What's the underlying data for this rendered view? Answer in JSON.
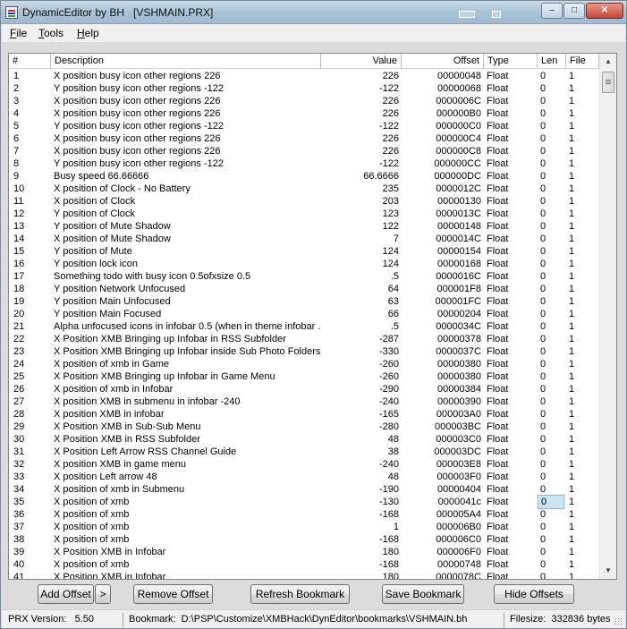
{
  "window": {
    "title": "DynamicEditor by BH   [VSHMAIN.PRX]"
  },
  "menubar": {
    "file": "File",
    "tools": "Tools",
    "help": "Help"
  },
  "columns": {
    "num": "#",
    "description": "Description",
    "value": "Value",
    "offset": "Offset",
    "type": "Type",
    "len": "Len",
    "file": "File"
  },
  "rows": [
    {
      "n": "1",
      "d": "X position busy icon other regions 226",
      "v": "226",
      "o": "00000048",
      "t": "Float",
      "l": "0",
      "f": "1"
    },
    {
      "n": "2",
      "d": "Y position busy icon other regions -122",
      "v": "-122",
      "o": "00000068",
      "t": "Float",
      "l": "0",
      "f": "1"
    },
    {
      "n": "3",
      "d": "X position busy icon other regions 226",
      "v": "226",
      "o": "0000006C",
      "t": "Float",
      "l": "0",
      "f": "1"
    },
    {
      "n": "4",
      "d": "X position busy icon other regions 226",
      "v": "226",
      "o": "000000B0",
      "t": "Float",
      "l": "0",
      "f": "1"
    },
    {
      "n": "5",
      "d": "Y position busy icon other regions -122",
      "v": "-122",
      "o": "000000C0",
      "t": "Float",
      "l": "0",
      "f": "1"
    },
    {
      "n": "6",
      "d": "X position busy icon other regions 226",
      "v": "226",
      "o": "000000C4",
      "t": "Float",
      "l": "0",
      "f": "1"
    },
    {
      "n": "7",
      "d": "X position busy icon other regions 226",
      "v": "226",
      "o": "000000C8",
      "t": "Float",
      "l": "0",
      "f": "1"
    },
    {
      "n": "8",
      "d": "Y position busy icon other regions -122",
      "v": "-122",
      "o": "000000CC",
      "t": "Float",
      "l": "0",
      "f": "1"
    },
    {
      "n": "9",
      "d": "Busy speed 66.66666",
      "v": "66.6666",
      "o": "000000DC",
      "t": "Float",
      "l": "0",
      "f": "1"
    },
    {
      "n": "10",
      "d": "X position of Clock - No Battery",
      "v": "235",
      "o": "0000012C",
      "t": "Float",
      "l": "0",
      "f": "1"
    },
    {
      "n": "11",
      "d": "X position of Clock",
      "v": "203",
      "o": "00000130",
      "t": "Float",
      "l": "0",
      "f": "1"
    },
    {
      "n": "12",
      "d": "Y position of Clock",
      "v": "123",
      "o": "0000013C",
      "t": "Float",
      "l": "0",
      "f": "1"
    },
    {
      "n": "13",
      "d": "Y position of Mute Shadow",
      "v": "122",
      "o": "00000148",
      "t": "Float",
      "l": "0",
      "f": "1"
    },
    {
      "n": "14",
      "d": "X position of Mute Shadow",
      "v": "7",
      "o": "0000014C",
      "t": "Float",
      "l": "0",
      "f": "1"
    },
    {
      "n": "15",
      "d": "Y position of Mute",
      "v": "124",
      "o": "00000154",
      "t": "Float",
      "l": "0",
      "f": "1"
    },
    {
      "n": "16",
      "d": "Y position lock icon",
      "v": "124",
      "o": "00000168",
      "t": "Float",
      "l": "0",
      "f": "1"
    },
    {
      "n": "17",
      "d": "Something todo with busy icon 0.5ofxsize    0.5",
      "v": ".5",
      "o": "0000016C",
      "t": "Float",
      "l": "0",
      "f": "1"
    },
    {
      "n": "18",
      "d": "Y position Network Unfocused",
      "v": "64",
      "o": "000001F8",
      "t": "Float",
      "l": "0",
      "f": "1"
    },
    {
      "n": "19",
      "d": "Y position Main Unfocused",
      "v": "63",
      "o": "000001FC",
      "t": "Float",
      "l": "0",
      "f": "1"
    },
    {
      "n": "20",
      "d": "Y position Main Focused",
      "v": "66",
      "o": "00000204",
      "t": "Float",
      "l": "0",
      "f": "1"
    },
    {
      "n": "21",
      "d": "Alpha unfocused icons in infobar 0.5 (when in theme infobar ...",
      "v": ".5",
      "o": "0000034C",
      "t": "Float",
      "l": "0",
      "f": "1"
    },
    {
      "n": "22",
      "d": "X Position XMB Bringing up Infobar in RSS Subfolder",
      "v": "-287",
      "o": "00000378",
      "t": "Float",
      "l": "0",
      "f": "1"
    },
    {
      "n": "23",
      "d": "X Position XMB Bringing up Infobar inside Sub Photo Folders",
      "v": "-330",
      "o": "0000037C",
      "t": "Float",
      "l": "0",
      "f": "1"
    },
    {
      "n": "24",
      "d": "X position of xmb in Game",
      "v": "-260",
      "o": "00000380",
      "t": "Float",
      "l": "0",
      "f": "1"
    },
    {
      "n": "25",
      "d": "X Position XMB Bringing up Infobar in Game Menu",
      "v": "-260",
      "o": "00000380",
      "t": "Float",
      "l": "0",
      "f": "1"
    },
    {
      "n": "26",
      "d": "X position of xmb in Infobar",
      "v": "-290",
      "o": "00000384",
      "t": "Float",
      "l": "0",
      "f": "1"
    },
    {
      "n": "27",
      "d": "X position XMB in submenu in infobar -240",
      "v": "-240",
      "o": "00000390",
      "t": "Float",
      "l": "0",
      "f": "1"
    },
    {
      "n": "28",
      "d": "X position XMB in infobar",
      "v": "-165",
      "o": "000003A0",
      "t": "Float",
      "l": "0",
      "f": "1"
    },
    {
      "n": "29",
      "d": "X Position XMB in Sub-Sub Menu",
      "v": "-280",
      "o": "000003BC",
      "t": "Float",
      "l": "0",
      "f": "1"
    },
    {
      "n": "30",
      "d": "X Position XMB in RSS Subfolder",
      "v": "48",
      "o": "000003C0",
      "t": "Float",
      "l": "0",
      "f": "1"
    },
    {
      "n": "31",
      "d": "X Position Left Arrow RSS Channel Guide",
      "v": "38",
      "o": "000003DC",
      "t": "Float",
      "l": "0",
      "f": "1"
    },
    {
      "n": "32",
      "d": "X position XMB in game menu",
      "v": "-240",
      "o": "000003E8",
      "t": "Float",
      "l": "0",
      "f": "1"
    },
    {
      "n": "33",
      "d": "X position Left arrow 48",
      "v": "48",
      "o": "000003F0",
      "t": "Float",
      "l": "0",
      "f": "1"
    },
    {
      "n": "34",
      "d": "X position of xmb in Submenu",
      "v": "-190",
      "o": "00000404",
      "t": "Float",
      "l": "0",
      "f": "1"
    },
    {
      "n": "35",
      "d": "X position of xmb",
      "v": "-130",
      "o": "0000041c",
      "t": "Float",
      "l": "0",
      "f": "1"
    },
    {
      "n": "36",
      "d": "X position of xmb",
      "v": "-168",
      "o": "000005A4",
      "t": "Float",
      "l": "0",
      "f": "1"
    },
    {
      "n": "37",
      "d": "X position of xmb",
      "v": "1",
      "o": "000006B0",
      "t": "Float",
      "l": "0",
      "f": "1"
    },
    {
      "n": "38",
      "d": "X position of xmb",
      "v": "-168",
      "o": "000006C0",
      "t": "Float",
      "l": "0",
      "f": "1"
    },
    {
      "n": "39",
      "d": "X Position XMB in Infobar",
      "v": "180",
      "o": "000006F0",
      "t": "Float",
      "l": "0",
      "f": "1"
    },
    {
      "n": "40",
      "d": "X position of xmb",
      "v": "-168",
      "o": "00000748",
      "t": "Float",
      "l": "0",
      "f": "1"
    },
    {
      "n": "41",
      "d": "X Position XMB in Infobar",
      "v": "180",
      "o": "0000078C",
      "t": "Float",
      "l": "0",
      "f": "1"
    }
  ],
  "buttons": {
    "add_offset": "Add Offset",
    "add_more": ">",
    "remove_offset": "Remove Offset",
    "refresh_bookmark": "Refresh Bookmark",
    "save_bookmark": "Save Bookmark",
    "hide_offsets": "Hide Offsets"
  },
  "status": {
    "prx_version": "PRX Version:   5.50",
    "bookmark": "Bookmark:  D:\\PSP\\Customize\\XMBHack\\DynEditor\\bookmarks\\VSHMAIN.bh",
    "filesize": "Filesize:  332836 bytes"
  },
  "icons": {
    "app": "app-icon",
    "minimize": "minimize-icon",
    "maximize": "maximize-icon",
    "close": "close-icon",
    "scroll_up": "triangle-up-icon",
    "scroll_down": "triangle-down-icon"
  },
  "colors": {
    "selection": "#cce4f7",
    "close_button": "#c4453a"
  }
}
